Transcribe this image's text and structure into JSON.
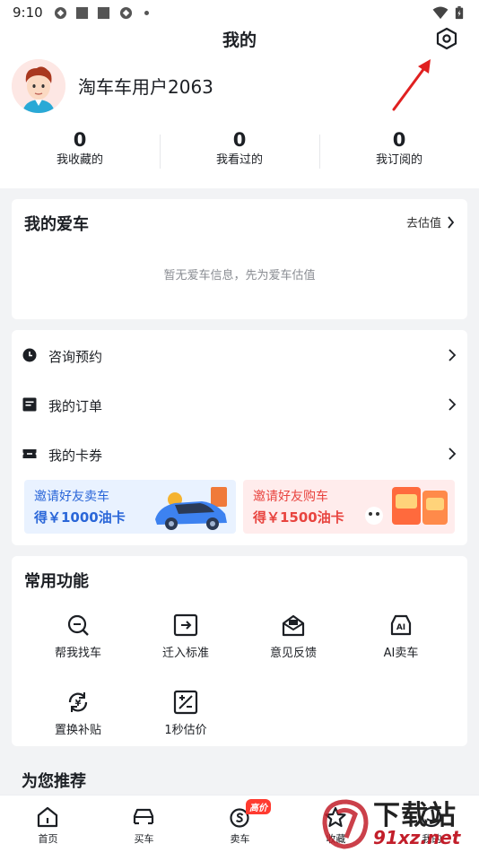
{
  "status_bar": {
    "time": "9:10"
  },
  "header": {
    "title": "我的"
  },
  "profile": {
    "username": "淘车车用户2063"
  },
  "stats": [
    {
      "value": "0",
      "label": "我收藏的"
    },
    {
      "value": "0",
      "label": "我看过的"
    },
    {
      "value": "0",
      "label": "我订阅的"
    }
  ],
  "my_car": {
    "title": "我的爱车",
    "action": "去估值",
    "empty_hint": "暂无爱车信息，先为爱车估值"
  },
  "menu": [
    {
      "label": "咨询预约",
      "icon": "clock-icon"
    },
    {
      "label": "我的订单",
      "icon": "order-icon"
    },
    {
      "label": "我的卡券",
      "icon": "ticket-icon"
    }
  ],
  "banners": {
    "sell": {
      "line1": "邀请好友卖车",
      "line2": "得￥1000油卡"
    },
    "buy": {
      "line1": "邀请好友购车",
      "line2": "得￥1500油卡"
    }
  },
  "functions": {
    "title": "常用功能",
    "items": [
      {
        "label": "帮我找车",
        "icon": "find-car-icon"
      },
      {
        "label": "迁入标准",
        "icon": "transfer-icon"
      },
      {
        "label": "意见反馈",
        "icon": "feedback-icon"
      },
      {
        "label": "AI卖车",
        "icon": "ai-sell-icon"
      },
      {
        "label": "置换补贴",
        "icon": "exchange-subsidy-icon"
      },
      {
        "label": "1秒估价",
        "icon": "quick-estimate-icon"
      }
    ]
  },
  "recommend": {
    "title": "为您推荐"
  },
  "tabbar": {
    "tabs": [
      {
        "label": "首页",
        "icon": "home-icon"
      },
      {
        "label": "买车",
        "icon": "car-icon"
      },
      {
        "label": "卖车",
        "icon": "sell-icon",
        "badge": "高价"
      },
      {
        "label": "收藏",
        "icon": "star-icon"
      },
      {
        "label": "我的",
        "icon": "profile-icon"
      }
    ]
  },
  "watermark": {
    "line1": "下载站",
    "line2": "91xz.net"
  },
  "colors": {
    "accent_blue": "#2a66d8",
    "accent_red": "#e8443f",
    "badge_red": "#ff3b30",
    "background": "#f2f3f5"
  }
}
